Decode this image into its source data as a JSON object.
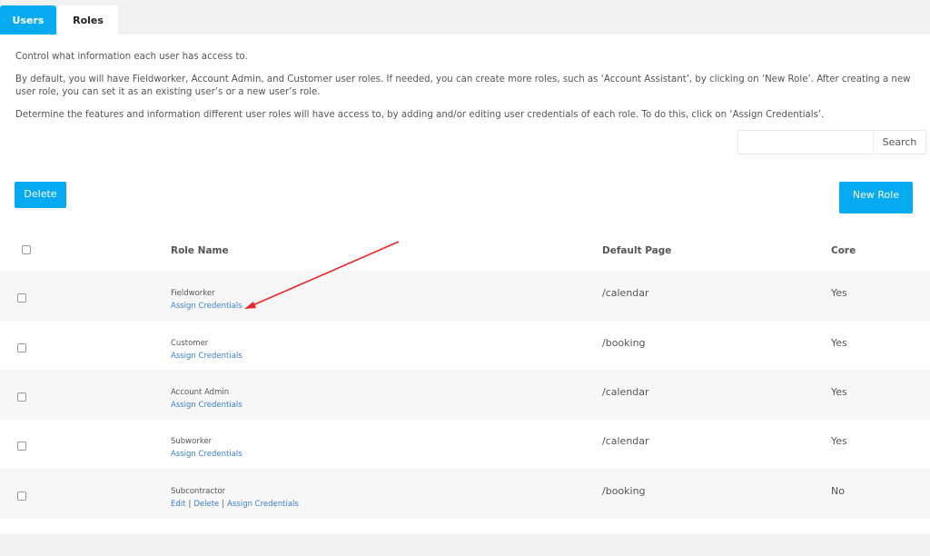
{
  "tabs": [
    {
      "label": "Users",
      "active": false
    },
    {
      "label": "Roles",
      "active": true
    }
  ],
  "description": {
    "line1": "Control what information each user has access to.",
    "line2": "By default, you will have Fieldworker, Account Admin, and Customer user roles. If needed, you can create more roles, such as ‘Account Assistant’, by clicking on ‘New Role’. After creating a new user role, you can set it as an existing user’s or a new user’s role.",
    "line3": "Determine the features and information different user roles will have access to, by adding and/or editing user credentials of each role. To do this, click on ‘Assign Credentials’."
  },
  "search": {
    "value": "",
    "placeholder": "",
    "button_label": "Search"
  },
  "toolbar": {
    "delete_label": "Delete",
    "new_role_label": "New Role"
  },
  "table": {
    "headers": {
      "role_name": "Role Name",
      "default_page": "Default Page",
      "core": "Core"
    },
    "rows": [
      {
        "name": "Fieldworker",
        "actions": [
          "Assign Credentials"
        ],
        "default_page": "/calendar",
        "core": "Yes"
      },
      {
        "name": "Customer",
        "actions": [
          "Assign Credentials"
        ],
        "default_page": "/booking",
        "core": "Yes"
      },
      {
        "name": "Account Admin",
        "actions": [
          "Assign Credentials"
        ],
        "default_page": "/calendar",
        "core": "Yes"
      },
      {
        "name": "Subworker",
        "actions": [
          "Assign Credentials"
        ],
        "default_page": "/calendar",
        "core": "Yes"
      },
      {
        "name": "Subcontractor",
        "actions": [
          "Edit",
          "Delete",
          "Assign Credentials"
        ],
        "default_page": "/booking",
        "core": "No"
      }
    ]
  },
  "annotation": {
    "type": "arrow",
    "color": "#e8262a",
    "points_to": "Fieldworker Assign Credentials link"
  },
  "colors": {
    "accent": "#06aaf1",
    "link": "#3a7ed0",
    "row_alt": "#f7f7f7"
  }
}
